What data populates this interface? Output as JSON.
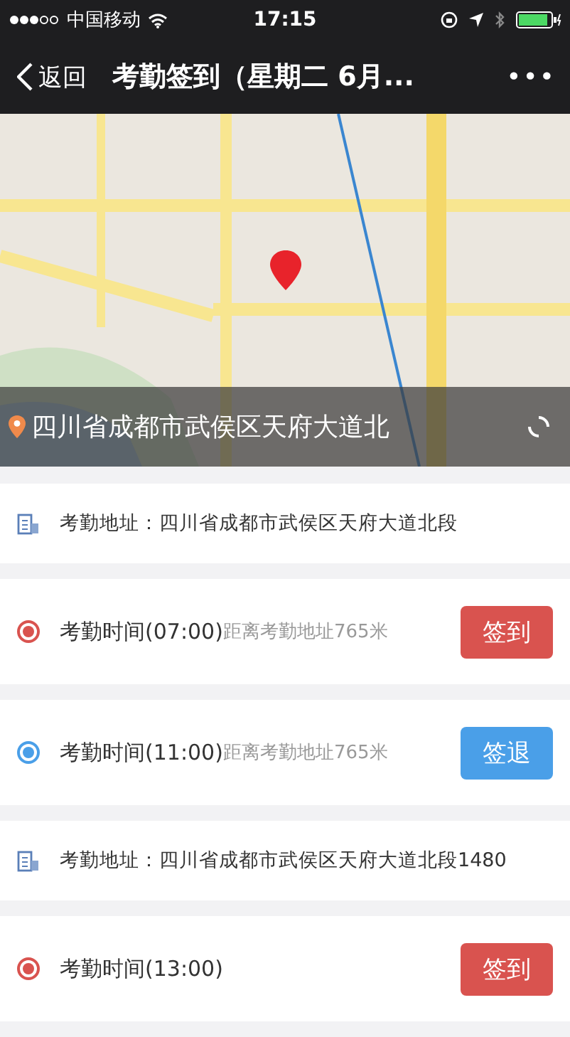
{
  "status_bar": {
    "carrier": "中国移动",
    "time": "17:15"
  },
  "nav": {
    "back": "返回",
    "title": "考勤签到（星期二 6月...",
    "more": "•••"
  },
  "map": {
    "address": "四川省成都市武侯区天府大道北"
  },
  "items": [
    {
      "kind": "address",
      "text": "考勤地址：四川省成都市武侯区天府大道北段"
    },
    {
      "kind": "time",
      "label": "考勤时间(07:00)",
      "distance": "距离考勤地址765米",
      "button": "签到",
      "color": "#d9534f"
    },
    {
      "kind": "time",
      "label": "考勤时间(11:00)",
      "distance": "距离考勤地址765米",
      "button": "签退",
      "color": "#4a9fe8"
    },
    {
      "kind": "address",
      "text": "考勤地址：四川省成都市武侯区天府大道北段1480"
    },
    {
      "kind": "time",
      "label": "考勤时间(13:00)",
      "button": "签到",
      "color": "#d9534f"
    }
  ]
}
